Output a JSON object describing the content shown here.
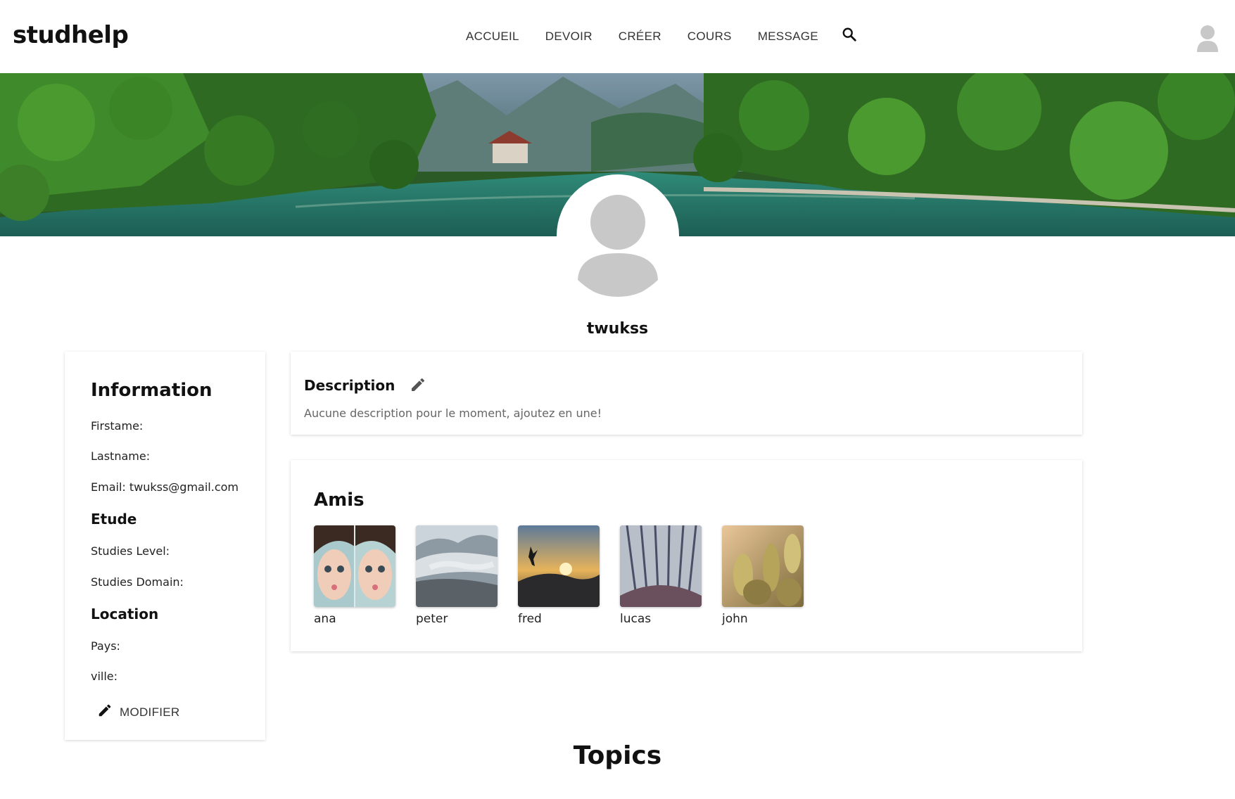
{
  "header": {
    "logo": "studhelp",
    "nav": [
      "ACCUEIL",
      "DEVOIR",
      "CRÉER",
      "COURS",
      "MESSAGE"
    ],
    "search_icon": "search-icon",
    "avatar_icon": "user-avatar-icon"
  },
  "profile": {
    "username": "twukss"
  },
  "information": {
    "title": "Information",
    "firstname_label": "Firstame:",
    "lastname_label": "Lastname:",
    "email": "Email: twukss@gmail.com",
    "etude_title": "Etude",
    "studies_level_label": "Studies Level:",
    "studies_domain_label": "Studies Domain:",
    "location_title": "Location",
    "pays_label": "Pays:",
    "ville_label": "ville:",
    "modify_label": "MODIFIER"
  },
  "description": {
    "title": "Description",
    "text": "Aucune description pour le moment, ajoutez en une!"
  },
  "friends": {
    "title": "Amis",
    "items": [
      {
        "name": "ana"
      },
      {
        "name": "peter"
      },
      {
        "name": "fred"
      },
      {
        "name": "lucas"
      },
      {
        "name": "john"
      }
    ]
  },
  "topics": {
    "title": "Topics"
  },
  "colors": {
    "avatar_gray": "#c8c8c8",
    "icon_gray": "#555555"
  }
}
